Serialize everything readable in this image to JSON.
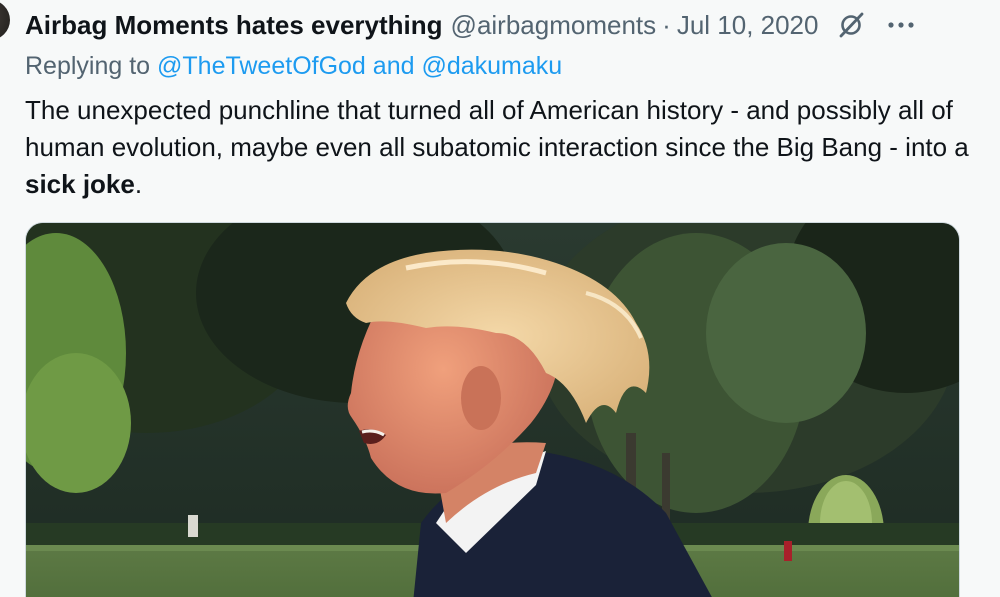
{
  "tweet": {
    "display_name": "Airbag Moments hates everything",
    "handle": "@airbagmoments",
    "separator": "·",
    "date": "Jul 10, 2020",
    "reply_prefix": "Replying to",
    "reply_mention_1": "@TheTweetOfGod",
    "reply_and": "and",
    "reply_mention_2": "@dakumaku",
    "text_main": "The unexpected punchline that turned all of American history - and possibly all of human evolution, maybe even all subatomic interaction since the Big Bang - into a ",
    "text_bold": "sick joke",
    "text_end": "."
  },
  "icons": {
    "grok": "grok-slash-icon",
    "more": "more-dots-icon"
  },
  "colors": {
    "background": "#f7f9f9",
    "text": "#0f1419",
    "secondary": "#536471",
    "link": "#1d9bf0"
  }
}
